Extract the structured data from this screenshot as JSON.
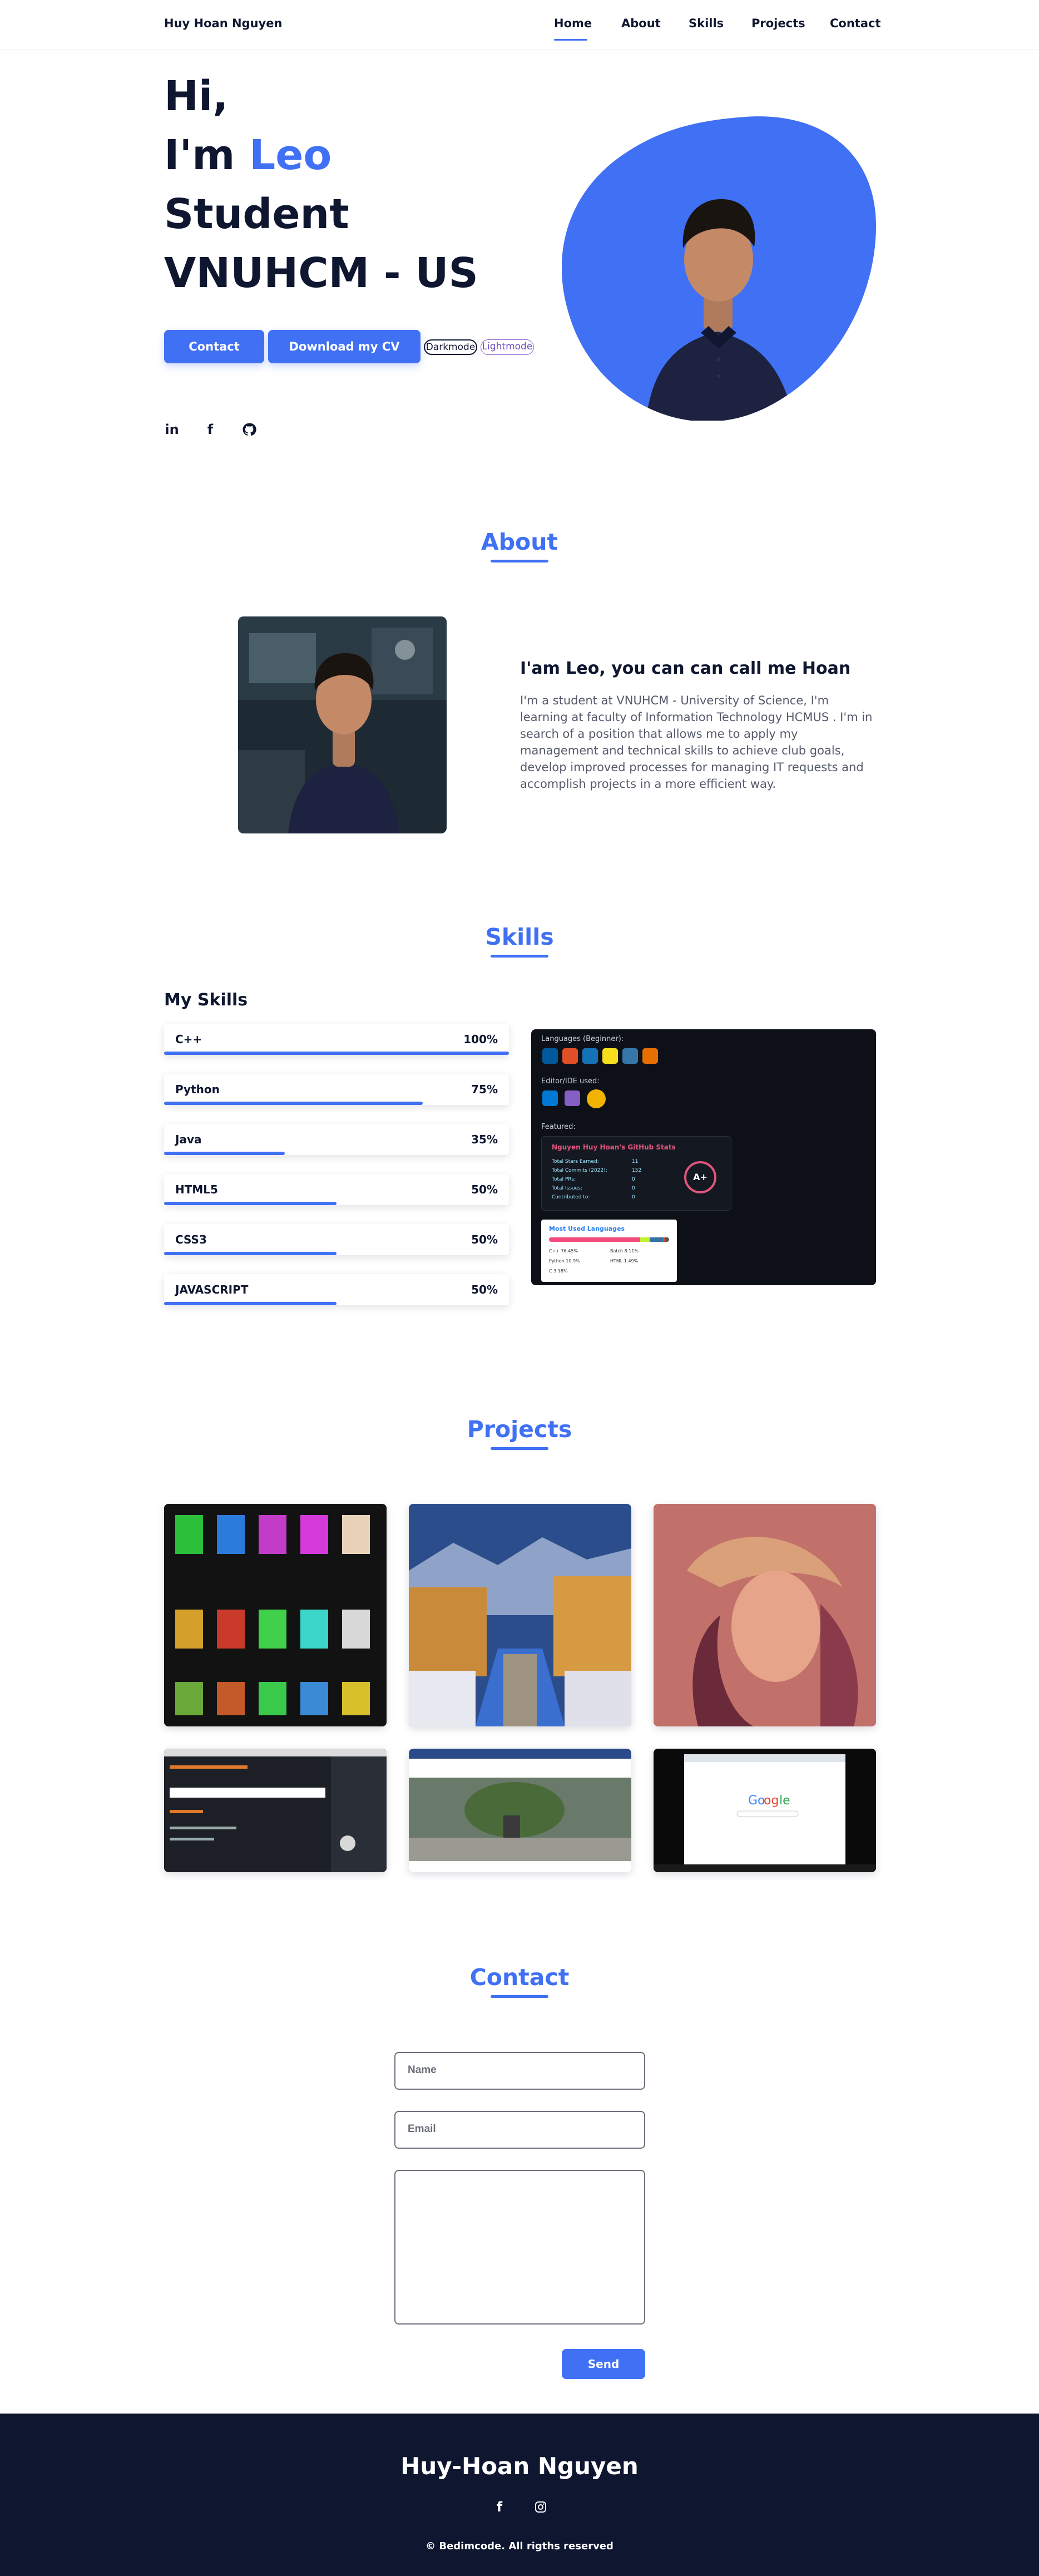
{
  "header": {
    "brand": "Huy Hoan Nguyen",
    "nav": [
      {
        "label": "Home",
        "active": true
      },
      {
        "label": "About",
        "active": false
      },
      {
        "label": "Skills",
        "active": false
      },
      {
        "label": "Projects",
        "active": false
      },
      {
        "label": "Contact",
        "active": false
      }
    ]
  },
  "hero": {
    "line1": "Hi,",
    "line2_prefix": "I'm ",
    "line2_name": "Leo",
    "line3": "Student",
    "line4": "VNUHCM - US",
    "contact_button": "Contact",
    "cv_button": "Download my CV",
    "dark_mode": "Darkmode",
    "light_mode": "Lightmode",
    "socials": [
      "in",
      "f",
      "github-icon"
    ]
  },
  "about": {
    "title": "About",
    "heading": "I'am Leo, you can can call me Hoan",
    "text": "I'm a student at VNUHCM - University of Science, I'm learning at faculty of Information Technology HCMUS . I'm in search of a position that allows me to apply my management and technical skills to achieve club goals, develop improved processes for managing IT requests and accomplish projects in a more efficient way."
  },
  "skills": {
    "title": "Skills",
    "subtitle": "My Skills",
    "items": [
      {
        "name": "C++",
        "percent": "100%",
        "level": 1.0
      },
      {
        "name": "Python",
        "percent": "75%",
        "level": 0.75
      },
      {
        "name": "Java",
        "percent": "35%",
        "level": 0.35
      },
      {
        "name": "HTML5",
        "percent": "50%",
        "level": 0.5
      },
      {
        "name": "CSS3",
        "percent": "50%",
        "level": 0.5
      },
      {
        "name": "JAVASCRIPT",
        "percent": "50%",
        "level": 0.5
      }
    ],
    "github": {
      "languages_label": "Languages (Beginner):",
      "editors_label": "Editor/IDE used:",
      "featured_label": "Featured:",
      "stats_title": "Nguyen Huy Hoan's GitHub Stats",
      "stats": [
        {
          "label": "Total Stars Earned:",
          "value": "11"
        },
        {
          "label": "Total Commits (2022):",
          "value": "152"
        },
        {
          "label": "Total PRs:",
          "value": "0"
        },
        {
          "label": "Total Issues:",
          "value": "0"
        },
        {
          "label": "Contributed to:",
          "value": "0"
        }
      ],
      "grade": "A+",
      "langs_title": "Most Used Languages",
      "langs": [
        "C++ 76.45%",
        "Batch 8.11%",
        "Python 10.9%",
        "HTML 1.49%",
        "C 3.18%"
      ]
    }
  },
  "projects": {
    "title": "Projects"
  },
  "contact": {
    "title": "Contact",
    "name_placeholder": "Name",
    "email_placeholder": "Email",
    "send": "Send"
  },
  "footer": {
    "title": "Huy-Hoan Nguyen",
    "copyright": "© Bedimcode. All rigths reserved"
  },
  "colors": {
    "accent": "#4070f4",
    "dark": "#0e1630"
  }
}
